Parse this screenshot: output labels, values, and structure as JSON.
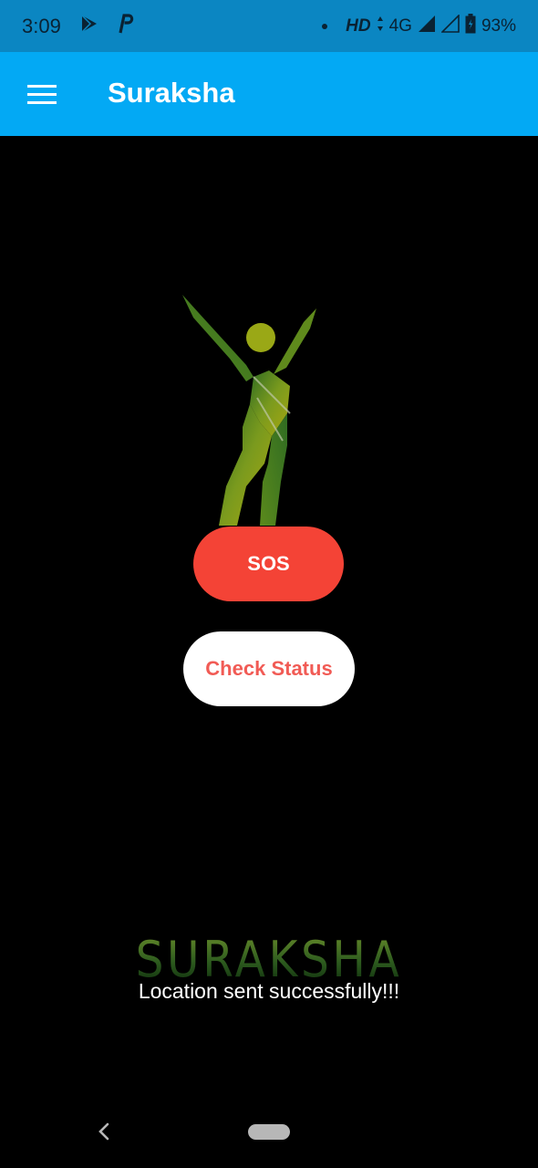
{
  "status_bar": {
    "time": "3:09",
    "hd": "HD",
    "network": "4G",
    "battery": "93%",
    "icons": [
      "play-store-icon",
      "pay-icon",
      "notification-dot-icon",
      "signal-icon",
      "battery-icon"
    ]
  },
  "appbar": {
    "title": "Suraksha",
    "color": "#03a9f4"
  },
  "main": {
    "sos_label": "SOS",
    "check_status_label": "Check Status",
    "brand_logo_text": "SURAKSHA",
    "toast": "Location sent successfully!!!"
  },
  "colors": {
    "sos": "#f44336",
    "check_status_text": "#f15b55",
    "background": "#000000"
  }
}
